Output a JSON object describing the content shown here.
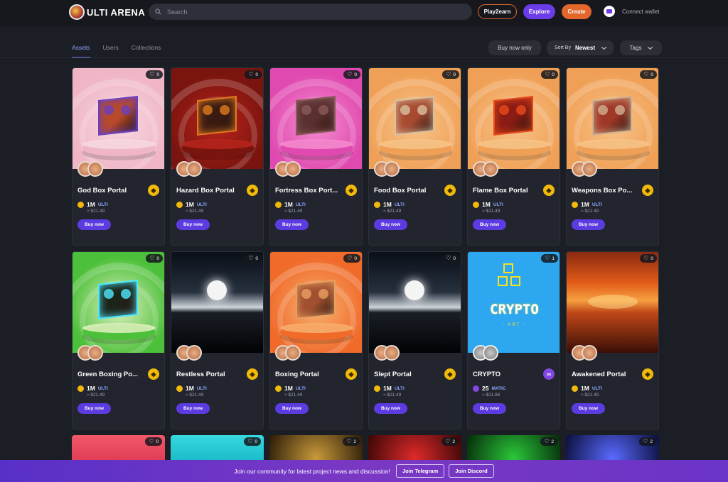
{
  "header": {
    "logo_text": "ULTI ARENA",
    "search_placeholder": "Search",
    "play2earn": "Play2earn",
    "explore": "Explore",
    "create": "Create",
    "connect_wallet": "Connect wallet"
  },
  "tabs": [
    {
      "label": "Assets",
      "active": true
    },
    {
      "label": "Users",
      "active": false
    },
    {
      "label": "Collections",
      "active": false
    }
  ],
  "filters": {
    "buy_now_only": "Buy now only",
    "sort_label": "Sort By",
    "sort_value": "Newest",
    "tags": "Tags"
  },
  "cards": [
    {
      "title": "God Box Portal",
      "likes": "0",
      "price": "1M",
      "currency": "ULTI",
      "usd": "≈ $21.49",
      "buy": "Buy now",
      "chain": "bnb"
    },
    {
      "title": "Hazard Box Portal",
      "likes": "0",
      "price": "1M",
      "currency": "ULTI",
      "usd": "≈ $21.49",
      "buy": "Buy now",
      "chain": "bnb"
    },
    {
      "title": "Fortress Box Port...",
      "likes": "0",
      "price": "1M",
      "currency": "ULTI",
      "usd": "≈ $21.49",
      "buy": "Buy now",
      "chain": "bnb"
    },
    {
      "title": "Food Box Portal",
      "likes": "0",
      "price": "1M",
      "currency": "ULTI",
      "usd": "≈ $21.49",
      "buy": "Buy now",
      "chain": "bnb"
    },
    {
      "title": "Flame Box Portal",
      "likes": "0",
      "price": "1M",
      "currency": "ULTI",
      "usd": "≈ $21.49",
      "buy": "Buy now",
      "chain": "bnb"
    },
    {
      "title": "Weapons Box Po...",
      "likes": "0",
      "price": "1M",
      "currency": "ULTI",
      "usd": "≈ $21.49",
      "buy": "Buy now",
      "chain": "bnb"
    },
    {
      "title": "Green Boxing Po...",
      "likes": "0",
      "price": "1M",
      "currency": "ULTI",
      "usd": "≈ $21.49",
      "buy": "Buy now",
      "chain": "bnb"
    },
    {
      "title": "Restless Portal",
      "likes": "0",
      "price": "1M",
      "currency": "ULTI",
      "usd": "≈ $21.49",
      "buy": "Buy now",
      "chain": "bnb"
    },
    {
      "title": "Boxing Portal",
      "likes": "0",
      "price": "1M",
      "currency": "ULTI",
      "usd": "≈ $21.49",
      "buy": "Buy now",
      "chain": "bnb"
    },
    {
      "title": "Slept Portal",
      "likes": "0",
      "price": "1M",
      "currency": "ULTI",
      "usd": "≈ $21.49",
      "buy": "Buy now",
      "chain": "bnb"
    },
    {
      "title": "CRYPTO",
      "likes": "1",
      "price": "25",
      "currency": "MATIC",
      "usd": "≈ $21.86",
      "buy": "Buy now",
      "chain": "matic",
      "art_title": "CRYPTO",
      "art_sub": "- ART -"
    },
    {
      "title": "Awakened Portal",
      "likes": "0",
      "price": "1M",
      "currency": "ULTI",
      "usd": "≈ $21.49",
      "buy": "Buy now",
      "chain": "bnb"
    }
  ],
  "row3_likes": [
    "0",
    "0",
    "2",
    "2",
    "2",
    "2"
  ],
  "banner": {
    "text": "Join our community for latest project news and discussion!",
    "telegram": "Join Telegram",
    "discord": "Join Discord"
  },
  "colors": {
    "accent": "#5c3ce0",
    "orange": "#e3662a",
    "bnb": "#f0b90b",
    "matic": "#8247e5"
  }
}
